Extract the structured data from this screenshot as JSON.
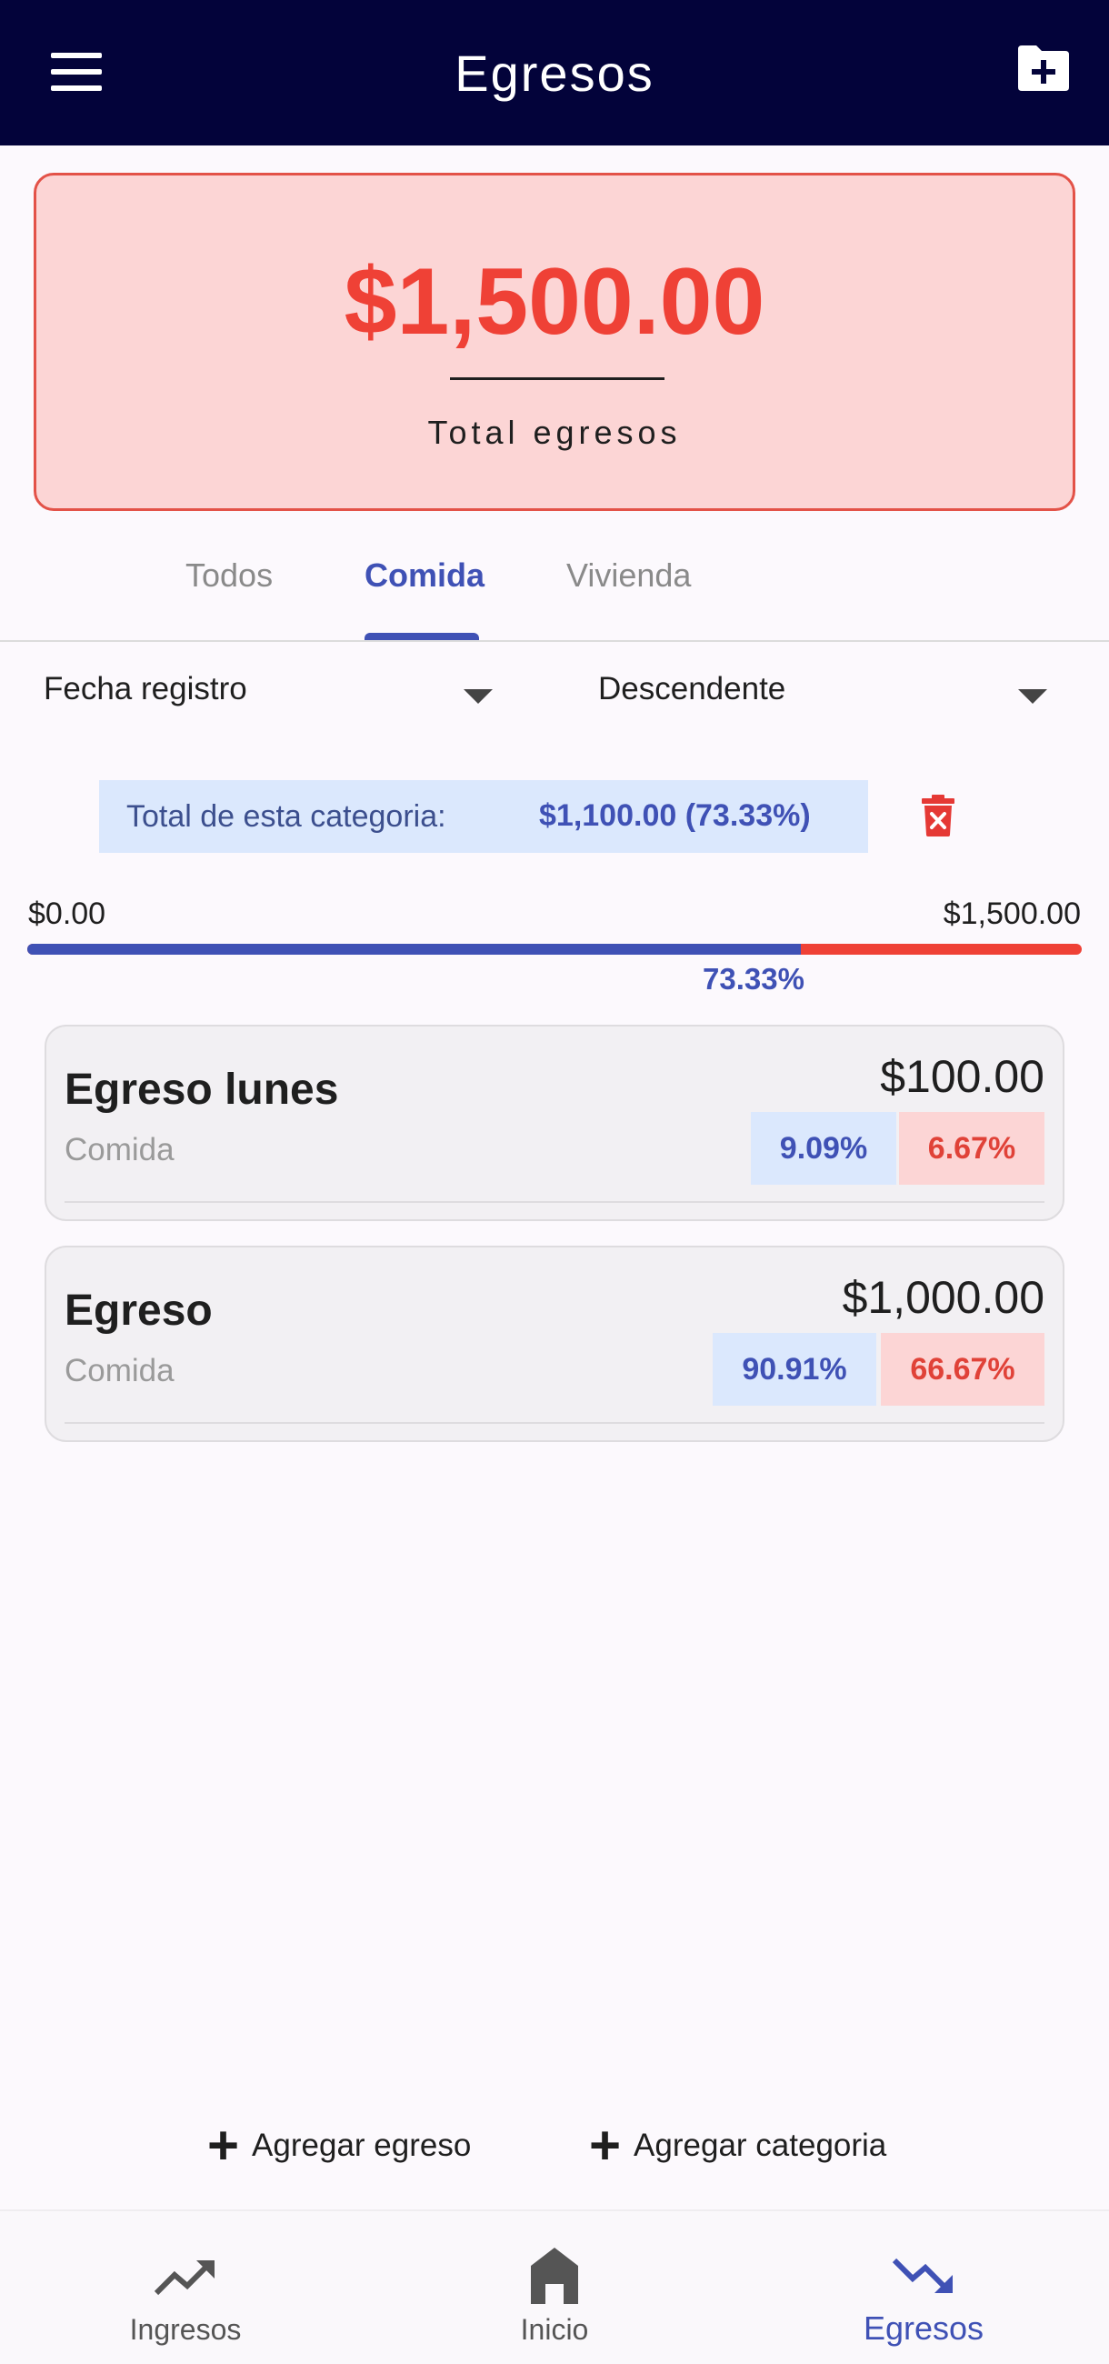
{
  "appbar": {
    "title": "Egresos",
    "menu_icon": "menu-icon",
    "action_icon": "folder-add-icon",
    "background": "#03033a"
  },
  "summary": {
    "total_amount": "$1,500.00",
    "total_label": "Total egresos",
    "accent": "#ef4136"
  },
  "tabs": [
    {
      "label": "Todos",
      "active": false
    },
    {
      "label": "Comida",
      "active": true
    },
    {
      "label": "Vivienda",
      "active": false
    }
  ],
  "sort": {
    "field": "Fecha registro",
    "order": "Descendente"
  },
  "category": {
    "total_label": "Total de esta categoria:",
    "total_value": "$1,100.00 (73.33%)",
    "delete_icon": "trash-icon"
  },
  "progress": {
    "min_label": "$0.00",
    "max_label": "$1,500.00",
    "percent_label": "73.33%",
    "fraction": 0.7333,
    "fill_color": "#3f51b5",
    "remainder_color": "#ef4136"
  },
  "items": [
    {
      "name": "Egreso lunes",
      "category": "Comida",
      "amount": "$100.00",
      "pct_category": "9.09%",
      "pct_total": "6.67%"
    },
    {
      "name": "Egreso",
      "category": "Comida",
      "amount": "$1,000.00",
      "pct_category": "90.91%",
      "pct_total": "66.67%"
    }
  ],
  "actions": {
    "add_expense": "Agregar egreso",
    "add_category": "Agregar categoria"
  },
  "bottom_nav": [
    {
      "label": "Ingresos",
      "icon": "trending-up-icon",
      "active": false
    },
    {
      "label": "Inicio",
      "icon": "home-icon",
      "active": false
    },
    {
      "label": "Egresos",
      "icon": "trending-down-icon",
      "active": true
    }
  ]
}
